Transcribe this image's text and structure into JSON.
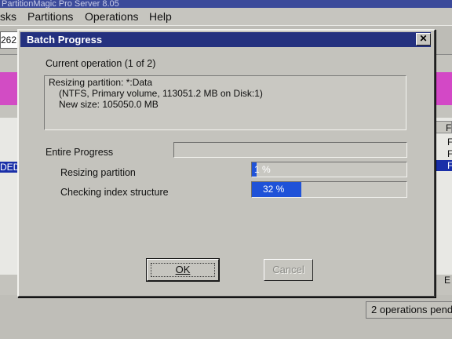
{
  "app": {
    "title": "PartitionMagic Pro Server 8.05",
    "menu": [
      "sks",
      "Partitions",
      "Operations",
      "Help"
    ],
    "toolbar_value": "262",
    "list_row_text": "DED",
    "column_header": "F",
    "col_cells": [
      "F",
      "F",
      "F"
    ],
    "side_letter": "E",
    "status_text": "2 operations pending"
  },
  "dialog": {
    "title": "Batch Progress",
    "close_label": "✕",
    "current_operation_label": "Current operation (1 of 2)",
    "operation_lines": [
      "Resizing partition: *:Data",
      "(NTFS, Primary volume, 113051.2 MB on Disk:1)",
      "New size: 105050.0 MB"
    ],
    "entire_progress_label": "Entire Progress",
    "tasks": [
      {
        "label": "Resizing partition",
        "progress_text": "1 %",
        "progress": 0.03
      },
      {
        "label": "Checking index structure",
        "progress_text": "32 %",
        "progress": 0.32
      }
    ],
    "entire_progress": 0.0,
    "ok_label": "OK",
    "cancel_label": "Cancel"
  },
  "colors": {
    "title_bar": "#24317f",
    "progress_fill": "#1f52d8",
    "disk_map": "#d348c6"
  }
}
